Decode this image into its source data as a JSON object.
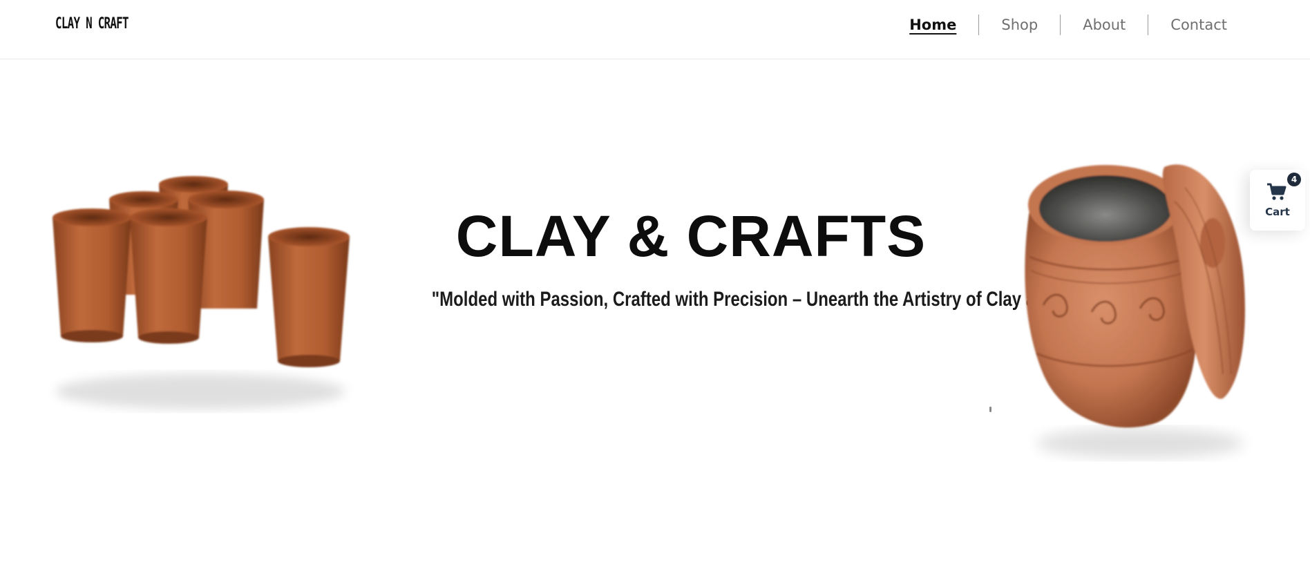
{
  "header": {
    "logo": "CLAY N CRAFT",
    "nav": [
      {
        "label": "Home",
        "active": true
      },
      {
        "label": "Shop",
        "active": false
      },
      {
        "label": "About",
        "active": false
      },
      {
        "label": "Contact",
        "active": false
      }
    ]
  },
  "hero": {
    "title": "CLAY & CRAFTS",
    "subtitle": "\"Molded with Passion, Crafted with Precision – Unearth the Artistry of Clay and Crafts!\"",
    "images": [
      "terracotta-cups",
      "terracotta-pot-with-lid"
    ]
  },
  "cart": {
    "label": "Cart",
    "count": "4",
    "icon": "cart-icon"
  },
  "colors": {
    "terracotta": "#b8653a",
    "terracotta_dark": "#8d4624",
    "pot": "#c97a52",
    "text": "#0d0d0d",
    "nav_inactive": "#6f6f6f",
    "cart_text": "#26364a"
  }
}
